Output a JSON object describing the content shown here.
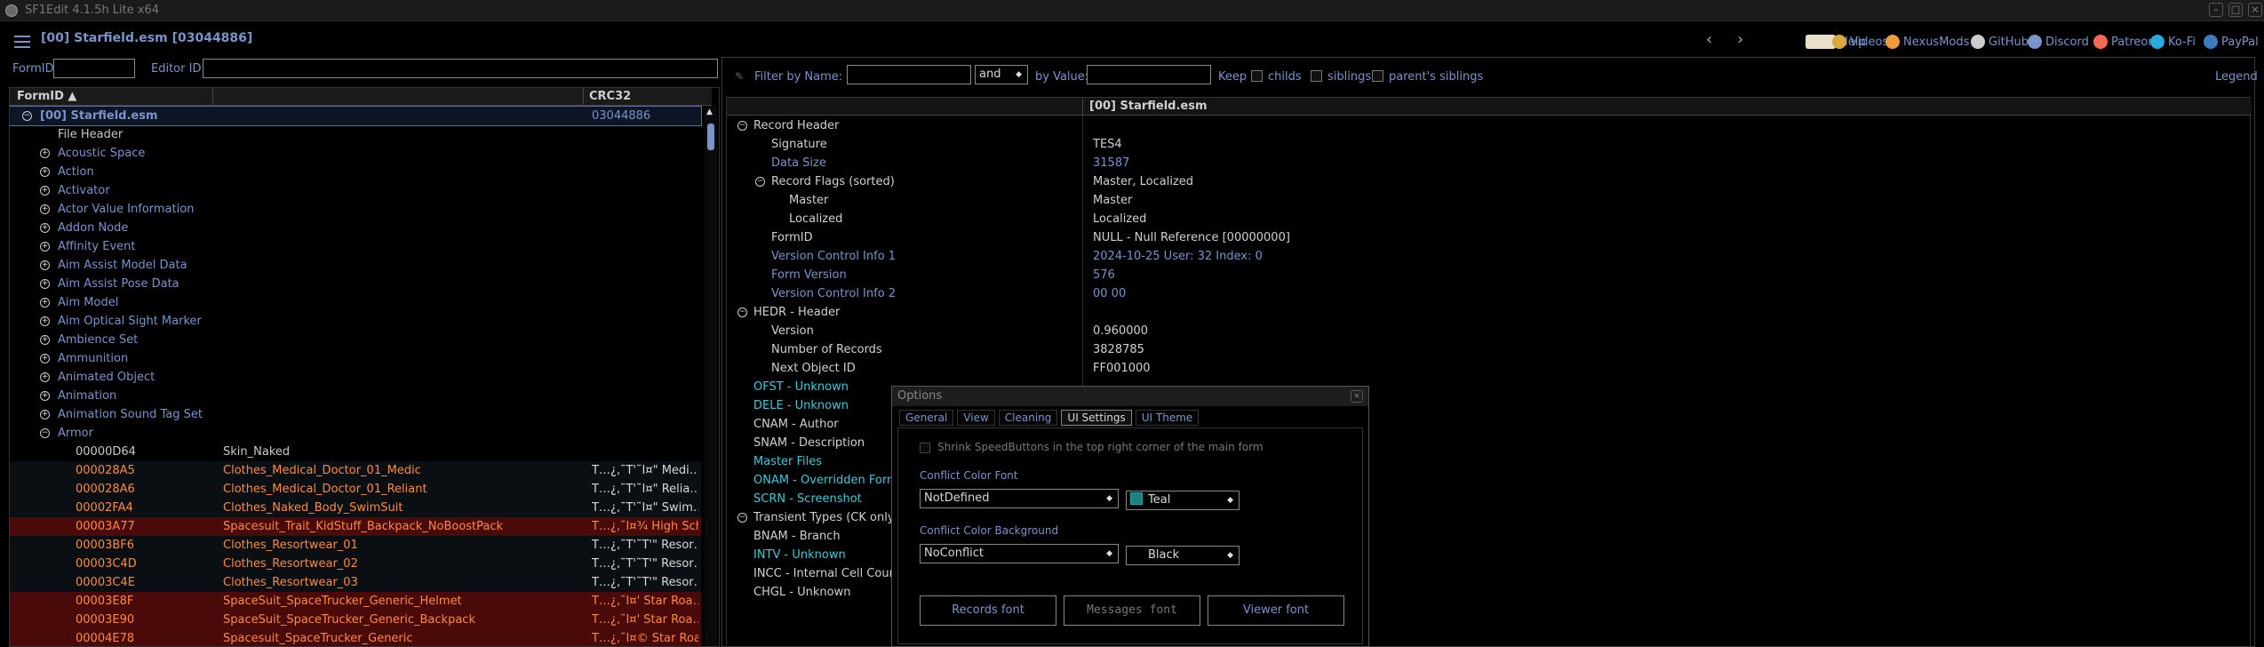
{
  "window": {
    "title": "SF1Edit 4.1.5h Lite x64"
  },
  "topbar": {
    "file_label": "[00] Starfield.esm [03044886]",
    "links": [
      {
        "label": "Help",
        "icon": "book-icon"
      },
      {
        "label": "Videos",
        "icon": "video-icon"
      },
      {
        "label": "NexusMods",
        "icon": "nexus-icon"
      },
      {
        "label": "GitHub",
        "icon": "github-icon"
      },
      {
        "label": "Discord",
        "icon": "discord-icon"
      },
      {
        "label": "Patreon",
        "icon": "patreon-icon"
      },
      {
        "label": "Ko-Fi",
        "icon": "kofi-icon"
      },
      {
        "label": "PayPal",
        "icon": "paypal-icon"
      }
    ]
  },
  "left": {
    "formid_label": "FormID",
    "editorid_label": "Editor ID",
    "columns": {
      "formid": "FormID ▲",
      "crc": "CRC32"
    },
    "root": {
      "label": "[00] Starfield.esm",
      "crc": "03044886"
    },
    "file_header": "File Header",
    "categories": [
      "Acoustic Space",
      "Action",
      "Activator",
      "Actor Value Information",
      "Addon Node",
      "Affinity Event",
      "Aim Assist Model Data",
      "Aim Assist Pose Data",
      "Aim Model",
      "Aim Optical Sight Marker",
      "Ambience Set",
      "Ammunition",
      "Animated Object",
      "Animation",
      "Animation Sound Tag Set",
      "Armor"
    ],
    "records": [
      {
        "id": "00000D64",
        "name": "Skin_Naked",
        "extra": "",
        "style": "plain"
      },
      {
        "id": "000028A5",
        "name": "Clothes_Medical_Doctor_01_Medic",
        "extra": "T…¿‚˜T'˜I¤\" Medi…",
        "style": "dark"
      },
      {
        "id": "000028A6",
        "name": "Clothes_Medical_Doctor_01_Reliant",
        "extra": "T…¿‚˜T'˜I¤\" Relia…",
        "style": "dark"
      },
      {
        "id": "00002FA4",
        "name": "Clothes_Naked_Body_SwimSuit",
        "extra": "T…¿‚˜T'˜I¤\" Swim…",
        "style": "dark"
      },
      {
        "id": "00003A77",
        "name": "Spacesuit_Trait_KidStuff_Backpack_NoBoostPack",
        "extra": "T…¿‚˜I¤¾ High Scho…",
        "style": "red"
      },
      {
        "id": "00003BF6",
        "name": "Clothes_Resortwear_01",
        "extra": "T…¿‚˜T'˜T'\" Resor…",
        "style": "dark"
      },
      {
        "id": "00003C4D",
        "name": "Clothes_Resortwear_02",
        "extra": "T…¿‚˜T'˜T'\" Resor…",
        "style": "dark"
      },
      {
        "id": "00003C4E",
        "name": "Clothes_Resortwear_03",
        "extra": "T…¿‚˜T'˜T'\" Resor…",
        "style": "dark"
      },
      {
        "id": "00003E8F",
        "name": "SpaceSuit_SpaceTrucker_Generic_Helmet",
        "extra": "T…¿‚˜I¤' Star Roa…",
        "style": "red"
      },
      {
        "id": "00003E90",
        "name": "SpaceSuit_SpaceTrucker_Generic_Backpack",
        "extra": "T…¿‚˜I¤' Star Roa…",
        "style": "red"
      },
      {
        "id": "00004E78",
        "name": "Spacesuit_SpaceTrucker_Generic",
        "extra": "T…¿‚˜I¤© Star Roa…",
        "style": "red"
      }
    ]
  },
  "right": {
    "filter": {
      "by_name": "Filter by Name:",
      "op": "and",
      "by_value": "by Value:",
      "keep": "Keep",
      "childs": "childs",
      "siblings": "siblings",
      "parents_siblings": "parent's siblings",
      "legend": "Legend"
    },
    "column_header": "[00] Starfield.esm",
    "rows": [
      {
        "name": "Record Header",
        "value": "",
        "indent": 1,
        "exp": true,
        "color": "plain"
      },
      {
        "name": "Signature",
        "value": "TES4",
        "indent": 2,
        "color": "plain"
      },
      {
        "name": "Data Size",
        "value": "31587",
        "indent": 2,
        "color": "blue",
        "vcolor": "blue"
      },
      {
        "name": "Record Flags (sorted)",
        "value": "Master, Localized",
        "indent": 2,
        "exp": true,
        "color": "plain"
      },
      {
        "name": "Master",
        "value": "Master",
        "indent": 3,
        "color": "plain"
      },
      {
        "name": "Localized",
        "value": "Localized",
        "indent": 3,
        "color": "plain"
      },
      {
        "name": "FormID",
        "value": "NULL - Null Reference [00000000]",
        "indent": 2,
        "color": "plain"
      },
      {
        "name": "Version Control Info 1",
        "value": "2024-10-25 User: 32 Index: 0",
        "indent": 2,
        "color": "blue",
        "vcolor": "blue"
      },
      {
        "name": "Form Version",
        "value": "576",
        "indent": 2,
        "color": "blue",
        "vcolor": "blue"
      },
      {
        "name": "Version Control Info 2",
        "value": "00 00",
        "indent": 2,
        "color": "blue",
        "vcolor": "blue"
      },
      {
        "name": "HEDR - Header",
        "value": "",
        "indent": 1,
        "exp": true,
        "color": "plain"
      },
      {
        "name": "Version",
        "value": "0.960000",
        "indent": 2,
        "color": "plain"
      },
      {
        "name": "Number of Records",
        "value": "3828785",
        "indent": 2,
        "color": "plain"
      },
      {
        "name": "Next Object ID",
        "value": "FF001000",
        "indent": 2,
        "color": "plain"
      },
      {
        "name": "OFST - Unknown",
        "value": "",
        "indent": 1,
        "color": "cyan"
      },
      {
        "name": "DELE - Unknown",
        "value": "",
        "indent": 1,
        "color": "cyan"
      },
      {
        "name": "CNAM - Author",
        "value": "",
        "indent": 1,
        "color": "plain"
      },
      {
        "name": "SNAM - Description",
        "value": "",
        "indent": 1,
        "color": "plain"
      },
      {
        "name": "Master Files",
        "value": "",
        "indent": 1,
        "color": "cyan"
      },
      {
        "name": "ONAM - Overridden Forms",
        "value": "",
        "indent": 1,
        "color": "cyan"
      },
      {
        "name": "SCRN - Screenshot",
        "value": "",
        "indent": 1,
        "color": "cyan"
      },
      {
        "name": "Transient Types (CK only)",
        "value": "",
        "indent": 1,
        "exp": true,
        "color": "plain"
      },
      {
        "name": "BNAM - Branch",
        "value": "",
        "indent": 1,
        "color": "plain"
      },
      {
        "name": "INTV - Unknown",
        "value": "",
        "indent": 1,
        "color": "cyan"
      },
      {
        "name": "INCC - Internal Cell Count",
        "value": "",
        "indent": 1,
        "color": "plain"
      },
      {
        "name": "CHGL - Unknown",
        "value": "",
        "indent": 1,
        "color": "plain"
      }
    ]
  },
  "options": {
    "title": "Options",
    "tabs": [
      "General",
      "View",
      "Cleaning",
      "UI Settings",
      "UI Theme"
    ],
    "active_tab": 3,
    "shrink_label": "Shrink SpeedButtons in the top right corner of the main form",
    "font_label": "Conflict Color Font",
    "font_value": "NotDefined",
    "font_color": "Teal",
    "bg_label": "Conflict Color Background",
    "bg_value": "NoConflict",
    "bg_color": "Black",
    "records_font": "Records font",
    "messages_font": "Messages font",
    "viewer_font": "Viewer font"
  },
  "colors": {
    "accent": "#7a93c9",
    "conflict_red": "#ff8a3d",
    "cyan": "#41c9d9",
    "teal": "#1a8080"
  }
}
